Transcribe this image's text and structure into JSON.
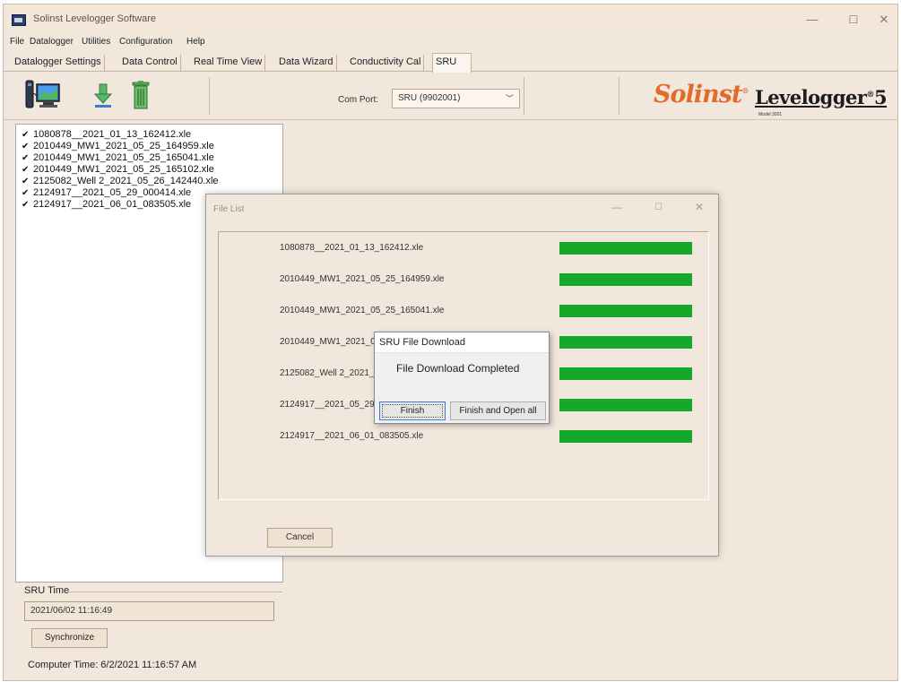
{
  "window": {
    "title": "Solinst Levelogger Software",
    "controls": {
      "minimize": "—",
      "maximize": "☐",
      "close": "✕"
    }
  },
  "menu": [
    "File",
    "Datalogger",
    "Utilities",
    "Configuration",
    "Help"
  ],
  "tabs": [
    "Datalogger Settings",
    "Data Control",
    "Real Time View",
    "Data Wizard",
    "Conductivity Cal",
    "SRU"
  ],
  "active_tab": "SRU",
  "toolbar": {
    "icons": [
      "sru-device-icon",
      "download-arrow-icon",
      "trash-icon"
    ],
    "com_port_label": "Com Port:",
    "com_port_value": "SRU (9902001)",
    "brand": {
      "solinst": "Solinst",
      "registered": "®",
      "product": "Levelogger",
      "product_edition": "5",
      "model": "Model 3001"
    },
    "brand_color": "#e36b2a"
  },
  "file_list": [
    {
      "checked": true,
      "name": "1080878__2021_01_13_162412.xle"
    },
    {
      "checked": true,
      "name": "2010449_MW1_2021_05_25_164959.xle"
    },
    {
      "checked": true,
      "name": "2010449_MW1_2021_05_25_165041.xle"
    },
    {
      "checked": true,
      "name": "2010449_MW1_2021_05_25_165102.xle"
    },
    {
      "checked": true,
      "name": "2125082_Well 2_2021_05_26_142440.xle"
    },
    {
      "checked": true,
      "name": "2124917__2021_05_29_000414.xle"
    },
    {
      "checked": true,
      "name": "2124917__2021_06_01_083505.xle"
    }
  ],
  "sru_time": {
    "group_label": "SRU Time",
    "value": "2021/06/02 11:16:49",
    "sync_button": "Synchronize",
    "computer_time": "Computer Time: 6/2/2021 11:16:57 AM"
  },
  "file_list_dialog": {
    "title": "File List",
    "controls": {
      "minimize": "—",
      "maximize": "☐",
      "close": "✕"
    },
    "rows": [
      {
        "name": "1080878__2021_01_13_162412.xle",
        "progress": 1.0
      },
      {
        "name": "2010449_MW1_2021_05_25_164959.xle",
        "progress": 1.0
      },
      {
        "name": "2010449_MW1_2021_05_25_165041.xle",
        "progress": 1.0
      },
      {
        "name": "2010449_MW1_2021_05",
        "progress": 1.0
      },
      {
        "name": "2125082_Well 2_2021_0",
        "progress": 1.0
      },
      {
        "name": "2124917__2021_05_29_",
        "progress": 1.0
      },
      {
        "name": "2124917__2021_06_01_083505.xle",
        "progress": 1.0
      }
    ],
    "progress_color": "#15a82a",
    "cancel_button": "Cancel"
  },
  "download_popup": {
    "title": "SRU File Download",
    "message": "File Download Completed",
    "finish_button": "Finish",
    "open_button": "Finish and Open all"
  }
}
